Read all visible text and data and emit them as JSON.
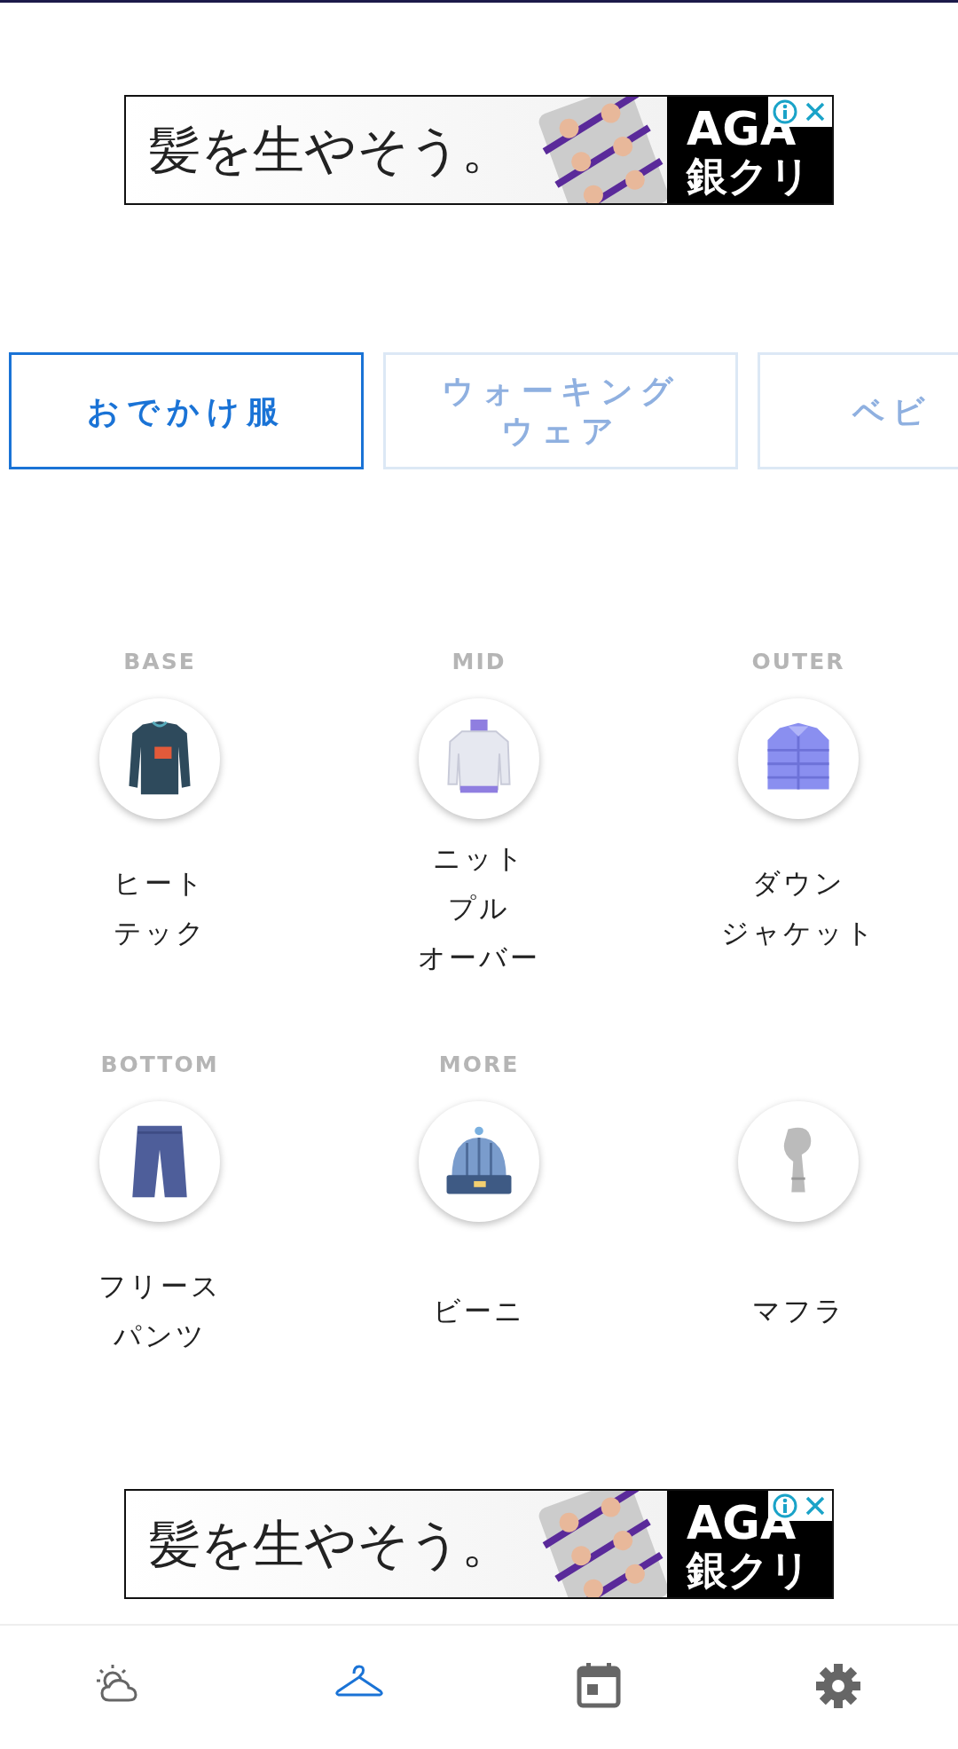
{
  "ads": [
    {
      "headline": "髪を生やそう。",
      "brand": "AGA",
      "brand_sub": "銀クリ"
    },
    {
      "headline": "髪を生やそう。",
      "brand": "AGA",
      "brand_sub": "銀クリ"
    }
  ],
  "tabs": [
    {
      "label": "おでかけ服",
      "selected": true
    },
    {
      "label": "ウォーキングウェア",
      "selected": false
    },
    {
      "label": "ベビ",
      "selected": false
    }
  ],
  "items": [
    {
      "category": "BASE",
      "name_lines": [
        "ヒート",
        "テック"
      ],
      "kind": "shirt"
    },
    {
      "category": "MID",
      "name_lines": [
        "ニット",
        "プル",
        "オーバー"
      ],
      "kind": "sweater"
    },
    {
      "category": "OUTER",
      "name_lines": [
        "ダウン",
        "ジャケット"
      ],
      "kind": "jacket"
    },
    {
      "category": "BOTTOM",
      "name_lines": [
        "フリース",
        "パンツ"
      ],
      "kind": "pants"
    },
    {
      "category": "MORE",
      "name_lines": [
        "ビーニ"
      ],
      "kind": "beanie"
    },
    {
      "name_lines": [
        "マフラ"
      ],
      "kind": "scarf"
    }
  ],
  "bottom_nav": [
    {
      "kind": "weather",
      "selected": false
    },
    {
      "kind": "wardrobe",
      "selected": true
    },
    {
      "kind": "calendar",
      "selected": false
    },
    {
      "kind": "settings",
      "selected": false
    }
  ]
}
